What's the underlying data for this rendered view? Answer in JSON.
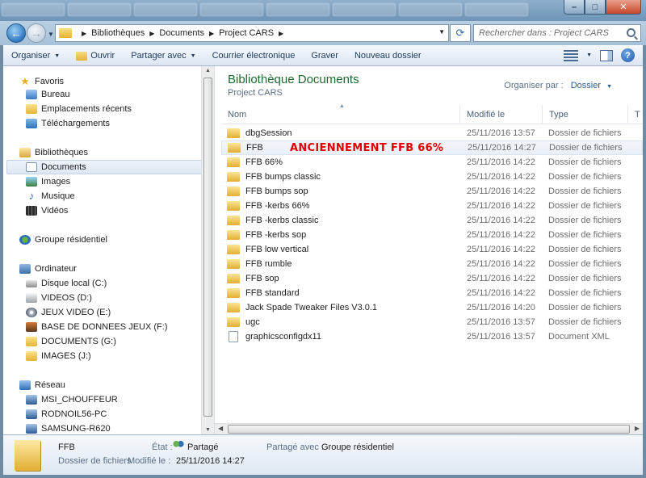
{
  "addressbar": {
    "crumbs": [
      "Bibliothèques",
      "Documents",
      "Project CARS"
    ],
    "search_placeholder": "Rechercher dans : Project CARS"
  },
  "commandbar": {
    "organize": "Organiser",
    "open": "Ouvrir",
    "share": "Partager avec",
    "email": "Courrier électronique",
    "burn": "Graver",
    "new_folder": "Nouveau dossier"
  },
  "nav": {
    "favorites": "Favoris",
    "desktop": "Bureau",
    "recent": "Emplacements récents",
    "downloads": "Téléchargements",
    "libraries": "Bibliothèques",
    "documents": "Documents",
    "images": "Images",
    "music": "Musique",
    "videos": "Vidéos",
    "homegroup": "Groupe résidentiel",
    "computer": "Ordinateur",
    "drive_c": "Disque local (C:)",
    "drive_d": "VIDEOS (D:)",
    "drive_e": "JEUX VIDEO (E:)",
    "drive_f": "BASE DE DONNEES JEUX (F:)",
    "drive_g": "DOCUMENTS (G:)",
    "drive_j": "IMAGES (J:)",
    "network": "Réseau",
    "net1": "MSI_CHOUFFEUR",
    "net2": "RODNOIL56-PC",
    "net3": "SAMSUNG-R620"
  },
  "content": {
    "title": "Bibliothèque Documents",
    "subtitle": "Project CARS",
    "arrange_label": "Organiser par :",
    "arrange_value": "Dossier",
    "columns": {
      "name": "Nom",
      "date": "Modifié le",
      "type": "Type",
      "more": "T"
    },
    "annotation": "ANCIENNEMENT FFB 66%",
    "files": [
      {
        "name": "dbgSession",
        "date": "25/11/2016 13:57",
        "type": "Dossier de fichiers"
      },
      {
        "name": "FFB",
        "date": "25/11/2016 14:27",
        "type": "Dossier de fichiers"
      },
      {
        "name": "FFB 66%",
        "date": "25/11/2016 14:22",
        "type": "Dossier de fichiers"
      },
      {
        "name": "FFB bumps classic",
        "date": "25/11/2016 14:22",
        "type": "Dossier de fichiers"
      },
      {
        "name": "FFB bumps sop",
        "date": "25/11/2016 14:22",
        "type": "Dossier de fichiers"
      },
      {
        "name": "FFB -kerbs 66%",
        "date": "25/11/2016 14:22",
        "type": "Dossier de fichiers"
      },
      {
        "name": "FFB -kerbs classic",
        "date": "25/11/2016 14:22",
        "type": "Dossier de fichiers"
      },
      {
        "name": "FFB -kerbs sop",
        "date": "25/11/2016 14:22",
        "type": "Dossier de fichiers"
      },
      {
        "name": "FFB low vertical",
        "date": "25/11/2016 14:22",
        "type": "Dossier de fichiers"
      },
      {
        "name": "FFB rumble",
        "date": "25/11/2016 14:22",
        "type": "Dossier de fichiers"
      },
      {
        "name": "FFB sop",
        "date": "25/11/2016 14:22",
        "type": "Dossier de fichiers"
      },
      {
        "name": "FFB standard",
        "date": "25/11/2016 14:22",
        "type": "Dossier de fichiers"
      },
      {
        "name": "Jack Spade Tweaker Files V3.0.1",
        "date": "25/11/2016 14:20",
        "type": "Dossier de fichiers"
      },
      {
        "name": "ugc",
        "date": "25/11/2016 13:57",
        "type": "Dossier de fichiers"
      },
      {
        "name": "graphicsconfigdx11",
        "date": "25/11/2016 13:57",
        "type": "Document XML"
      }
    ]
  },
  "details": {
    "name": "FFB",
    "kind": "Dossier de fichiers",
    "state_label": "État :",
    "state_value": "Partagé",
    "shared_label": "Partagé avec :",
    "shared_value": "Groupe résidentiel",
    "modified_label": "Modifié le :",
    "modified_value": "25/11/2016 14:27"
  }
}
